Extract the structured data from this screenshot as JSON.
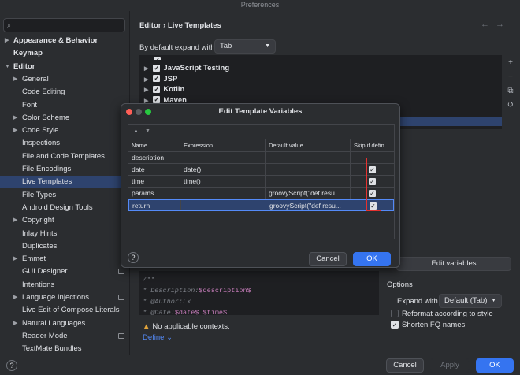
{
  "window": {
    "title": "Preferences"
  },
  "sidebar": {
    "search_placeholder": "",
    "items": [
      {
        "label": "Appearance & Behavior",
        "arrow": "›",
        "bold": true,
        "indent": 0
      },
      {
        "label": "Keymap",
        "arrow": "",
        "bold": true,
        "indent": 0
      },
      {
        "label": "Editor",
        "arrow": "⌄",
        "bold": true,
        "indent": 0
      },
      {
        "label": "General",
        "arrow": "›",
        "bold": false,
        "indent": 1
      },
      {
        "label": "Code Editing",
        "arrow": "",
        "bold": false,
        "indent": 1
      },
      {
        "label": "Font",
        "arrow": "",
        "bold": false,
        "indent": 1
      },
      {
        "label": "Color Scheme",
        "arrow": "›",
        "bold": false,
        "indent": 1
      },
      {
        "label": "Code Style",
        "arrow": "›",
        "bold": false,
        "indent": 1
      },
      {
        "label": "Inspections",
        "arrow": "",
        "bold": false,
        "indent": 1
      },
      {
        "label": "File and Code Templates",
        "arrow": "",
        "bold": false,
        "indent": 1
      },
      {
        "label": "File Encodings",
        "arrow": "",
        "bold": false,
        "indent": 1
      },
      {
        "label": "Live Templates",
        "arrow": "",
        "bold": false,
        "indent": 1,
        "selected": true
      },
      {
        "label": "File Types",
        "arrow": "",
        "bold": false,
        "indent": 1
      },
      {
        "label": "Android Design Tools",
        "arrow": "",
        "bold": false,
        "indent": 1
      },
      {
        "label": "Copyright",
        "arrow": "›",
        "bold": false,
        "indent": 1
      },
      {
        "label": "Inlay Hints",
        "arrow": "",
        "bold": false,
        "indent": 1
      },
      {
        "label": "Duplicates",
        "arrow": "",
        "bold": false,
        "indent": 1
      },
      {
        "label": "Emmet",
        "arrow": "›",
        "bold": false,
        "indent": 1
      },
      {
        "label": "GUI Designer",
        "arrow": "",
        "bold": false,
        "indent": 1,
        "badge": true
      },
      {
        "label": "Intentions",
        "arrow": "",
        "bold": false,
        "indent": 1
      },
      {
        "label": "Language Injections",
        "arrow": "›",
        "bold": false,
        "indent": 1,
        "badge": true
      },
      {
        "label": "Live Edit of Compose Literals",
        "arrow": "",
        "bold": false,
        "indent": 1
      },
      {
        "label": "Natural Languages",
        "arrow": "›",
        "bold": false,
        "indent": 1
      },
      {
        "label": "Reader Mode",
        "arrow": "",
        "bold": false,
        "indent": 1,
        "badge": true
      },
      {
        "label": "TextMate Bundles",
        "arrow": "",
        "bold": false,
        "indent": 1
      }
    ]
  },
  "header": {
    "breadcrumb": "Editor  ›  Live Templates",
    "back_icon": "←",
    "forward_icon": "→"
  },
  "expand": {
    "label": "By default expand with",
    "value": "Tab"
  },
  "template_groups": [
    {
      "label": "JavaScript Testing"
    },
    {
      "label": "JSP"
    },
    {
      "label": "Kotlin"
    },
    {
      "label": "Maven"
    }
  ],
  "side_tools": [
    "+",
    "−",
    "⧉",
    "↺"
  ],
  "editor": {
    "lines": [
      {
        "prefix": "/**",
        "var": "",
        "rest": ""
      },
      {
        "prefix": " * Description:",
        "var": "$description$",
        "rest": ""
      },
      {
        "prefix": " * @Author:Lx",
        "var": "",
        "rest": ""
      },
      {
        "prefix": " * @Date:",
        "var": "$date$ $time$",
        "rest": ""
      }
    ]
  },
  "context": {
    "warning": "No applicable contexts.",
    "define": "Define ⌄"
  },
  "edit_variables_button": "Edit variables",
  "options": {
    "title": "Options",
    "expand_with_label": "Expand with",
    "expand_with_value": "Default (Tab)",
    "reformat": {
      "label": "Reformat according to style",
      "checked": false
    },
    "shorten": {
      "label": "Shorten FQ names",
      "checked": true
    }
  },
  "dialog": {
    "title": "Edit Template Variables",
    "columns": [
      "Name",
      "Expression",
      "Default value",
      "Skip if defin..."
    ],
    "rows": [
      {
        "name": "description",
        "expression": "",
        "default": "",
        "skip": false
      },
      {
        "name": "date",
        "expression": "date()",
        "default": "",
        "skip": true
      },
      {
        "name": "time",
        "expression": "time()",
        "default": "",
        "skip": true
      },
      {
        "name": "params",
        "expression": "",
        "default": "groovyScript(\"def resu...",
        "skip": true
      },
      {
        "name": "return",
        "expression": "",
        "default": "groovyScript(\"def resu...",
        "skip": true,
        "selected": true
      }
    ],
    "cancel": "Cancel",
    "ok": "OK",
    "help": "?"
  },
  "footer": {
    "cancel": "Cancel",
    "apply": "Apply",
    "ok": "OK",
    "help": "?"
  },
  "colors": {
    "accent": "#3574f0",
    "selection": "#2e436e",
    "highlight_box": "#e5312f"
  }
}
